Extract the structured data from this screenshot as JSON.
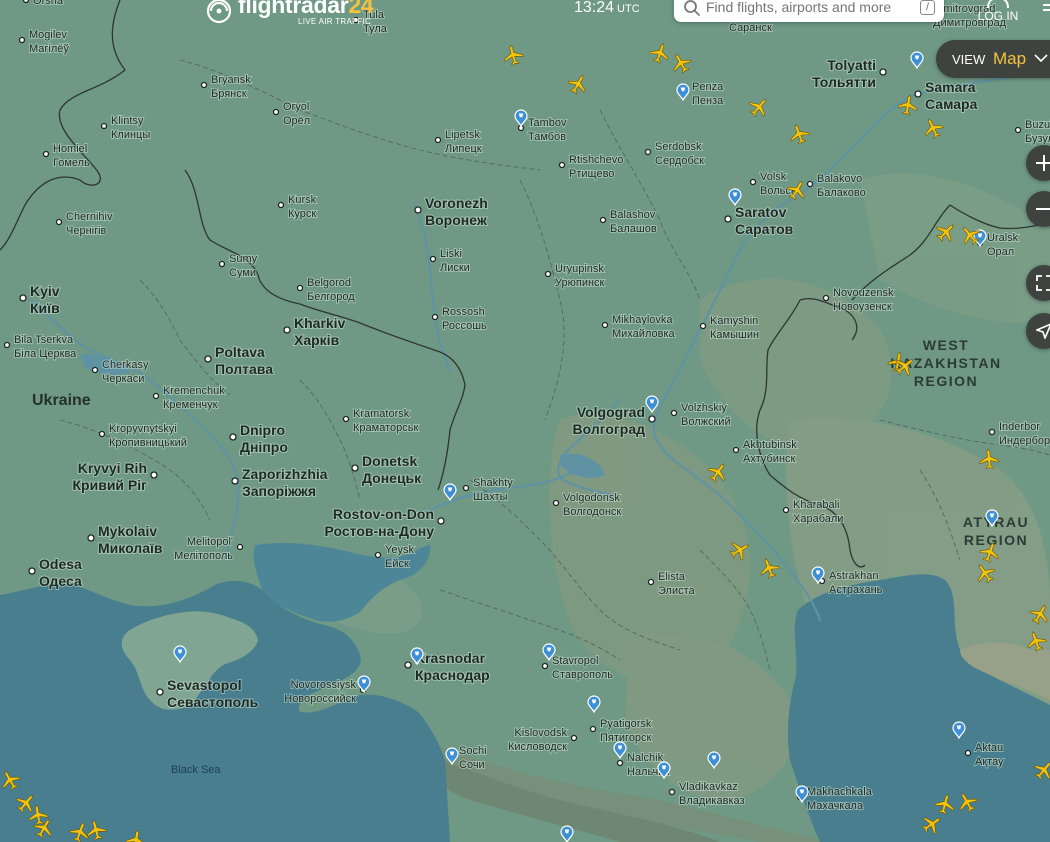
{
  "header": {
    "logo_text": "flightradar",
    "logo_number": "24",
    "tagline": "LIVE AIR TRAFFIC",
    "time": "13:24",
    "timezone": "UTC",
    "search_placeholder": "Find flights, airports and more",
    "search_shortcut": "/",
    "login_label": "LOG IN"
  },
  "view_selector": {
    "label": "VIEW",
    "value": "Map"
  },
  "map_controls": [
    "zoom-in",
    "zoom-out",
    "fullscreen",
    "locate"
  ],
  "colors": {
    "aircraft": "#f2c40c",
    "airport_pin": "#3d8fd8",
    "land": "#6f9985",
    "sea": "#487e8e",
    "border": "#2d3632"
  },
  "map": {
    "cities": [
      {
        "name": "Orsha",
        "native": ""
      },
      {
        "name": "Mogilev",
        "native": "Магілёў"
      },
      {
        "name": "Bryansk",
        "native": "Брянск"
      },
      {
        "name": "Oryol",
        "native": "Орёл"
      },
      {
        "name": "Klintsy",
        "native": "Клинцы"
      },
      {
        "name": "Homiel",
        "native": "Гомель"
      },
      {
        "name": "Lipetsk",
        "native": "Липецк"
      },
      {
        "name": "Tambov",
        "native": "Тамбов"
      },
      {
        "name": "Penza",
        "native": "Пенза"
      },
      {
        "name": "Serdobsk",
        "native": "Сердобск"
      },
      {
        "name": "Rtishchevo",
        "native": "Ртищево"
      },
      {
        "name": "Tolyatti",
        "native": "Тольятти"
      },
      {
        "name": "Samara",
        "native": "Самара"
      },
      {
        "name": "Kursk",
        "native": "Курск"
      },
      {
        "name": "Voronezh",
        "native": "Воронеж"
      },
      {
        "name": "Volsk",
        "native": "Вольск"
      },
      {
        "name": "Balakovo",
        "native": "Балаково"
      },
      {
        "name": "Saratov",
        "native": "Саратов"
      },
      {
        "name": "Balashov",
        "native": "Балашов"
      },
      {
        "name": "Chernihiv",
        "native": "Чернігів"
      },
      {
        "name": "Sumy",
        "native": "Суми"
      },
      {
        "name": "Liski",
        "native": "Лиски"
      },
      {
        "name": "Uryupinsk",
        "native": "Урюпинск"
      },
      {
        "name": "Belgorod",
        "native": "Белгород"
      },
      {
        "name": "Kyiv",
        "native": "Київ"
      },
      {
        "name": "Rossosh",
        "native": "Россошь"
      },
      {
        "name": "Novouzensk",
        "native": "Новоузенск"
      },
      {
        "name": "Kharkiv",
        "native": "Харків"
      },
      {
        "name": "Mikhaylovka",
        "native": "Михайловка"
      },
      {
        "name": "Kamyshin",
        "native": "Камышин"
      },
      {
        "name": "Bila Tserkva",
        "native": "Біла Церква"
      },
      {
        "name": "Poltava",
        "native": "Полтава"
      },
      {
        "name": "Cherkasy",
        "native": "Черкаси"
      },
      {
        "name": "Kremenchuk",
        "native": "Кременчук"
      },
      {
        "name": "Volgograd",
        "native": "Волгоград"
      },
      {
        "name": "Volzhskiy",
        "native": "Волжский"
      },
      {
        "name": "Kramatorsk",
        "native": "Краматорськ"
      },
      {
        "name": "Kropyvnytskyi",
        "native": "Кропивницький"
      },
      {
        "name": "Dnipro",
        "native": "Дніпро"
      },
      {
        "name": "Akhtubinsk",
        "native": "Ахтубинск"
      },
      {
        "name": "Inderbor",
        "native": "Индербор"
      },
      {
        "name": "Kryvyi Rih",
        "native": "Кривий Ріг"
      },
      {
        "name": "Zaporizhzhia",
        "native": "Запоріжжя"
      },
      {
        "name": "Donetsk",
        "native": "Донецьк"
      },
      {
        "name": "Shakhty",
        "native": "Шахты"
      },
      {
        "name": "Volgodonsk",
        "native": "Волгодонск"
      },
      {
        "name": "Kharabali",
        "native": "Харабали"
      },
      {
        "name": "Rostov-on-Don",
        "native": "Ростов-на-Дону"
      },
      {
        "name": "Mykolaiv",
        "native": "Миколаїв"
      },
      {
        "name": "Yeysk",
        "native": "Ейск"
      },
      {
        "name": "Melitopol'",
        "native": "Мелітополь"
      },
      {
        "name": "Odesa",
        "native": "Одеса"
      },
      {
        "name": "Elista",
        "native": "Элиста"
      },
      {
        "name": "Astrakhan",
        "native": "Астрахань"
      },
      {
        "name": "Krasnodar",
        "native": "Краснодар"
      },
      {
        "name": "Stavropol",
        "native": "Ставрополь"
      },
      {
        "name": "Sevastopol",
        "native": "Севастополь"
      },
      {
        "name": "Novorossiysk",
        "native": "Новороссийск"
      },
      {
        "name": "Pyatigorsk",
        "native": "Пятигорск"
      },
      {
        "name": "Kislovodsk",
        "native": "Кисловодск"
      },
      {
        "name": "Aktau",
        "native": "Ақтау"
      },
      {
        "name": "Nalchik",
        "native": "Нальчик"
      },
      {
        "name": "Vladikavkaz",
        "native": "Владикавказ"
      },
      {
        "name": "Makhachkala",
        "native": "Махачкала"
      },
      {
        "name": "Sochi",
        "native": "Сочи"
      },
      {
        "name": "Uralsk",
        "native": "Орал"
      },
      {
        "name": "Buzuluk",
        "native": "Бузулук"
      },
      {
        "name": "Dimitrovgrad",
        "native": "Димитровград"
      },
      {
        "name": "Saransk",
        "native": "Саранск"
      },
      {
        "name": "Tula",
        "native": "Тула"
      }
    ],
    "countries": [
      {
        "name": "Ukraine"
      }
    ],
    "regions": [
      {
        "lines": [
          "WEST",
          "KAZAKHSTAN",
          "REGION"
        ]
      },
      {
        "lines": [
          "ATYRAU",
          "REGION"
        ]
      }
    ],
    "seas": [
      {
        "name": "Black Sea"
      }
    ]
  }
}
